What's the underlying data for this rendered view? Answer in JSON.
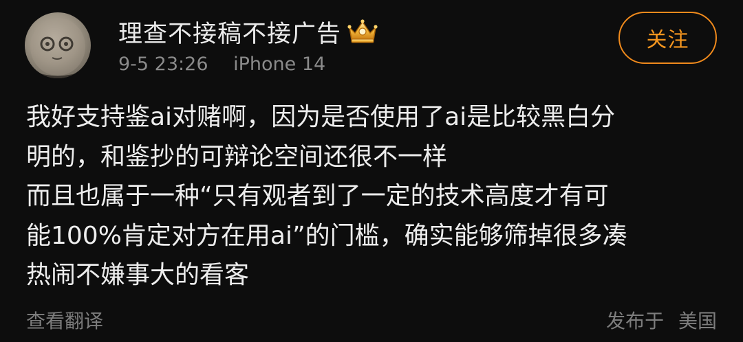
{
  "author": {
    "name": "理查不接稿不接广告",
    "badge_icon": "vip-crown-icon",
    "avatar": "stone-face-avatar"
  },
  "meta": {
    "time": "9-5 23:26",
    "device": "iPhone 14"
  },
  "follow_button": {
    "label": "关注",
    "color": "#f5961f"
  },
  "content": {
    "lines": [
      "我好支持鉴ai对赌啊，因为是否使用了ai是比较黑白分",
      "明的，和鉴抄的可辩论空间还很不一样",
      "而且也属于一种“只有观者到了一定的技术高度才有可",
      "能100%肯定对方在用ai”的门槛，确实能够筛掉很多凑",
      "热闹不嫌事大的看客"
    ]
  },
  "footer": {
    "translate_label": "查看翻译",
    "location_prefix": "发布于",
    "location": "美国"
  },
  "colors": {
    "background": "#0d0d0d",
    "text": "#ededed",
    "muted": "#8a8a8a",
    "accent": "#f08a1c"
  }
}
